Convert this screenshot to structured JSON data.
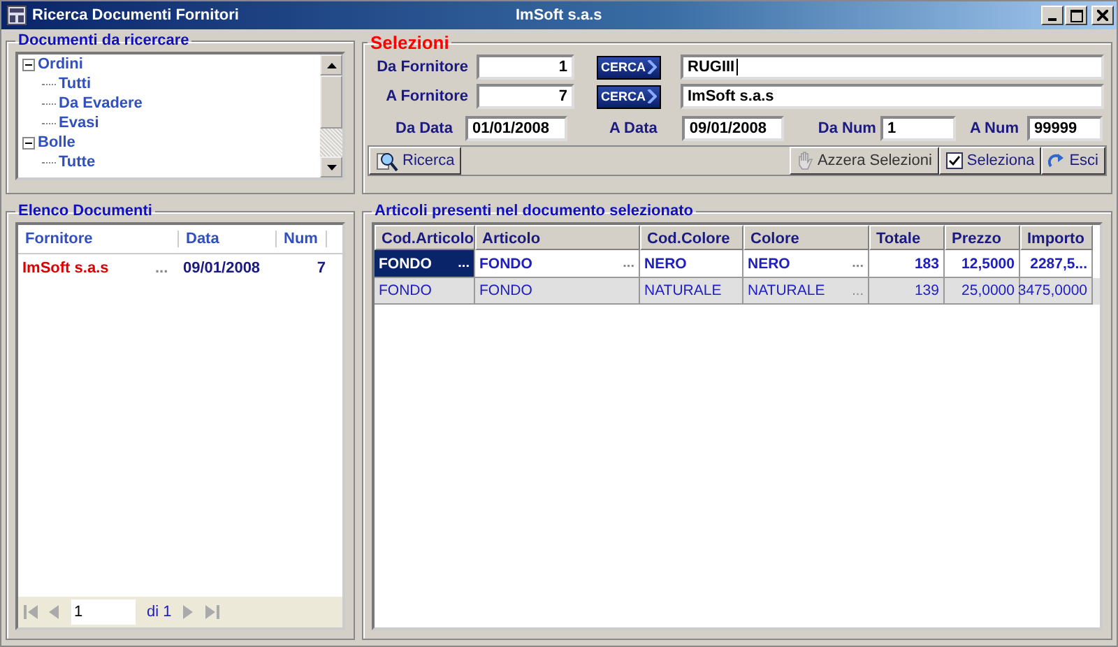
{
  "window": {
    "title": "Ricerca Documenti Fornitori",
    "subtitle": "ImSoft s.a.s"
  },
  "tree_group": {
    "title": "Documenti da ricercare",
    "items": [
      {
        "label": "Ordini",
        "expanded": true,
        "children": [
          {
            "label": "Tutti"
          },
          {
            "label": "Da Evadere"
          },
          {
            "label": "Evasi"
          }
        ]
      },
      {
        "label": "Bolle",
        "expanded": true,
        "children": [
          {
            "label": "Tutte"
          }
        ]
      }
    ]
  },
  "selections": {
    "title": "Selezioni",
    "from_supplier": {
      "label": "Da Fornitore",
      "value": "1",
      "button": "CERCA",
      "name": "RUGIII"
    },
    "to_supplier": {
      "label": "A Fornitore",
      "value": "7",
      "button": "CERCA",
      "name": "ImSoft s.a.s"
    },
    "from_date": {
      "label": "Da Data",
      "value": "01/01/2008"
    },
    "to_date": {
      "label": "A Data",
      "value": "09/01/2008"
    },
    "from_num": {
      "label": "Da Num",
      "value": "1"
    },
    "to_num": {
      "label": "A Num",
      "value": "99999"
    },
    "search_button": "Ricerca",
    "actions": [
      {
        "kind": "reset",
        "label": "Azzera Selezioni",
        "disabled": true
      },
      {
        "kind": "select",
        "label": "Seleziona",
        "disabled": false
      },
      {
        "kind": "exit",
        "label": "Esci",
        "disabled": false
      }
    ]
  },
  "documents": {
    "title": "Elenco Documenti",
    "columns": [
      "Fornitore",
      "Data",
      "Num"
    ],
    "rows": [
      {
        "supplier": "ImSoft s.a.s",
        "button": "...",
        "date": "09/01/2008",
        "num": "7"
      }
    ],
    "pager": {
      "page": "1",
      "total": "di 1"
    }
  },
  "articles": {
    "title": "Articoli presenti nel documento selezionato",
    "columns": [
      "Cod.Articolo",
      "Articolo",
      "Cod.Colore",
      "Colore",
      "Totale",
      "Prezzo",
      "Importo"
    ],
    "rows": [
      {
        "selected": true,
        "cells": [
          {
            "text": "FONDO",
            "button": "..."
          },
          {
            "text": "FONDO",
            "button": "..."
          },
          {
            "text": "NERO"
          },
          {
            "text": "NERO",
            "button": "..."
          },
          {
            "text": "183"
          },
          {
            "text": "12,5000"
          },
          {
            "text": "2287,5..."
          }
        ]
      },
      {
        "selected": false,
        "cells": [
          {
            "text": "FONDO"
          },
          {
            "text": "FONDO"
          },
          {
            "text": "NATURALE"
          },
          {
            "text": "NATURALE",
            "button": "..."
          },
          {
            "text": "139"
          },
          {
            "text": "25,0000"
          },
          {
            "text": "3475,0000"
          }
        ]
      }
    ]
  }
}
